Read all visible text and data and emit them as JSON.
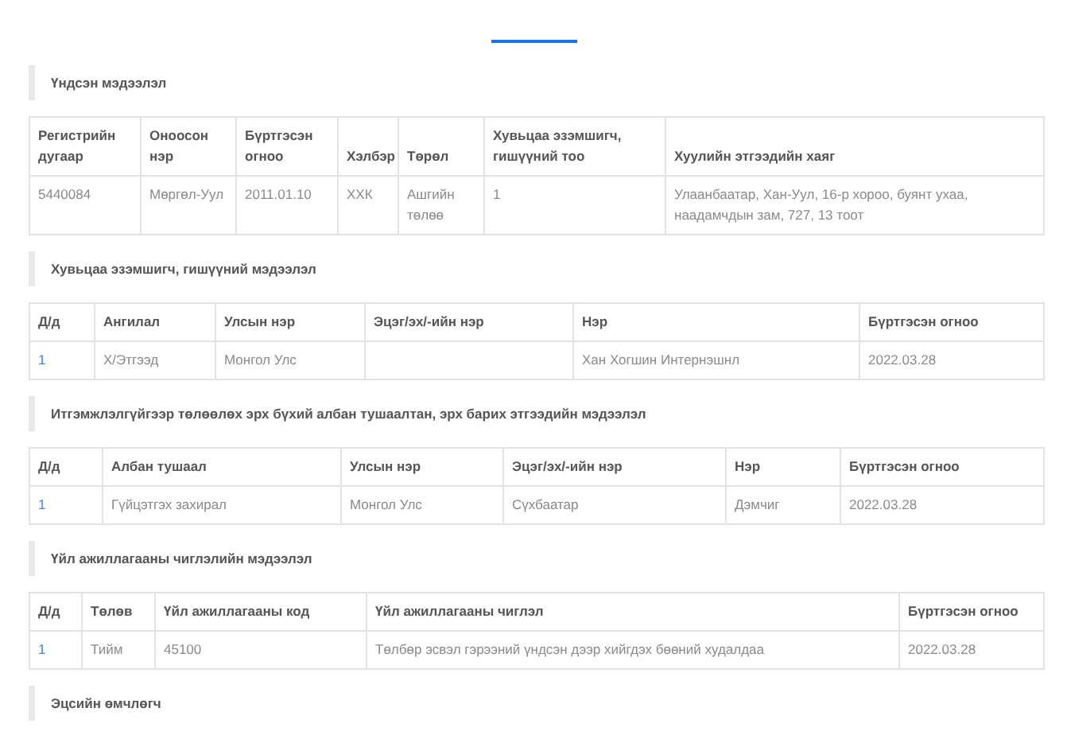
{
  "sections": [
    {
      "heading": "Үндсэн мэдээлэл",
      "table": {
        "columns": [
          {
            "label": "Регистрийн дугаар",
            "kind": "text"
          },
          {
            "label": "Оноосон нэр",
            "kind": "text"
          },
          {
            "label": "Бүртгэсэн огноо",
            "kind": "text"
          },
          {
            "label": "Хэлбэр",
            "kind": "text"
          },
          {
            "label": "Төрөл",
            "kind": "text"
          },
          {
            "label": "Хувьцаа эзэмшигч, гишүүний тоо",
            "kind": "text"
          },
          {
            "label": "Хуулийн этгээдийн хаяг",
            "kind": "text"
          }
        ],
        "rows": [
          [
            "5440084",
            "Мөргөл-Уул",
            "2011.01.10",
            "ХХК",
            "Ашгийн төлөө",
            "1",
            "Улаанбаатар, Хан-Уул, 16-р хороо, буянт ухаа, наадамчдын зам, 727, 13 тоот"
          ]
        ]
      }
    },
    {
      "heading": "Хувьцаа эзэмшигч, гишүүний мэдээлэл",
      "table": {
        "columns": [
          {
            "label": "Д/д",
            "kind": "index"
          },
          {
            "label": "Ангилал",
            "kind": "text"
          },
          {
            "label": "Улсын нэр",
            "kind": "text"
          },
          {
            "label": "Эцэг/эх/-ийн нэр",
            "kind": "text"
          },
          {
            "label": "Нэр",
            "kind": "text"
          },
          {
            "label": "Бүртгэсэн огноо",
            "kind": "text"
          }
        ],
        "rows": [
          [
            "1",
            "Х/Этгээд",
            "Монгол Улс",
            "",
            "Хан Хогшин Интернэшнл",
            "2022.03.28"
          ]
        ]
      }
    },
    {
      "heading": "Итгэмжлэлгүйгээр төлөөлөх эрх бүхий албан тушаалтан, эрх барих этгээдийн мэдээлэл",
      "table": {
        "columns": [
          {
            "label": "Д/д",
            "kind": "index"
          },
          {
            "label": "Албан тушаал",
            "kind": "text"
          },
          {
            "label": "Улсын нэр",
            "kind": "text"
          },
          {
            "label": "Эцэг/эх/-ийн нэр",
            "kind": "text"
          },
          {
            "label": "Нэр",
            "kind": "text"
          },
          {
            "label": "Бүртгэсэн огноо",
            "kind": "text"
          }
        ],
        "rows": [
          [
            "1",
            "Гүйцэтгэх захирал",
            "Монгол Улс",
            "Сүхбаатар",
            "Дэмчиг",
            "2022.03.28"
          ]
        ]
      }
    },
    {
      "heading": "Үйл ажиллагааны чиглэлийн мэдээлэл",
      "table": {
        "columns": [
          {
            "label": "Д/д",
            "kind": "index"
          },
          {
            "label": "Төлөв",
            "kind": "text"
          },
          {
            "label": "Үйл ажиллагааны код",
            "kind": "text"
          },
          {
            "label": "Үйл ажиллагааны чиглэл",
            "kind": "text"
          },
          {
            "label": "Бүртгэсэн огноо",
            "kind": "text"
          }
        ],
        "rows": [
          [
            "1",
            "Тийм",
            "45100",
            "Төлбөр эсвэл гэрээний үндсэн дээр хийгдэх бөөний худалдаа",
            "2022.03.28"
          ]
        ]
      }
    },
    {
      "heading": "Эцсийн өмчлөгч"
    }
  ]
}
